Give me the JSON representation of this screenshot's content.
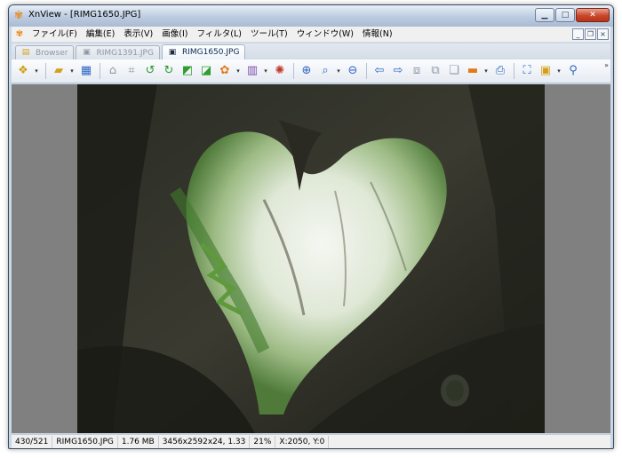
{
  "window": {
    "title": "XnView - [RIMG1650.JPG]"
  },
  "menu": {
    "items": [
      "ファイル(F)",
      "編集(E)",
      "表示(V)",
      "画像(I)",
      "フィルタ(L)",
      "ツール(T)",
      "ウィンドウ(W)",
      "情報(N)"
    ]
  },
  "tabs": [
    {
      "label": "Browser",
      "icon": "browser-icon",
      "active": false
    },
    {
      "label": "RIMG1391.JPG",
      "icon": "image-icon",
      "active": false
    },
    {
      "label": "RIMG1650.JPG",
      "icon": "image-icon",
      "active": true
    }
  ],
  "toolbar": {
    "icons": [
      "browser-tree-icon",
      "open-folder-icon",
      "save-icon",
      "scan-icon",
      "crop-icon",
      "rotate-left-icon",
      "rotate-right-icon",
      "image-import-icon",
      "image-export-icon",
      "batch-icon",
      "color-palette-icon",
      "effects-icon",
      "zoom-in-icon",
      "zoom-fit-icon",
      "zoom-out-icon",
      "previous-icon",
      "next-icon",
      "first-page-icon",
      "last-page-icon",
      "copy-icon",
      "slideshow-icon",
      "print-icon",
      "fullscreen-icon",
      "capture-icon",
      "find-icon"
    ]
  },
  "colors": {
    "title_bar": "#bccbe0",
    "viewer_background": "#808080",
    "close_button": "#c8472b"
  },
  "image": {
    "description_name": "forest-heart-photo"
  },
  "status": {
    "position": "430/521",
    "filename": "RIMG1650.JPG",
    "filesize": "1.76 MB",
    "dimensions": "3456x2592x24, 1.33",
    "zoom": "21%",
    "coordinates": "X:2050, Y:0"
  }
}
